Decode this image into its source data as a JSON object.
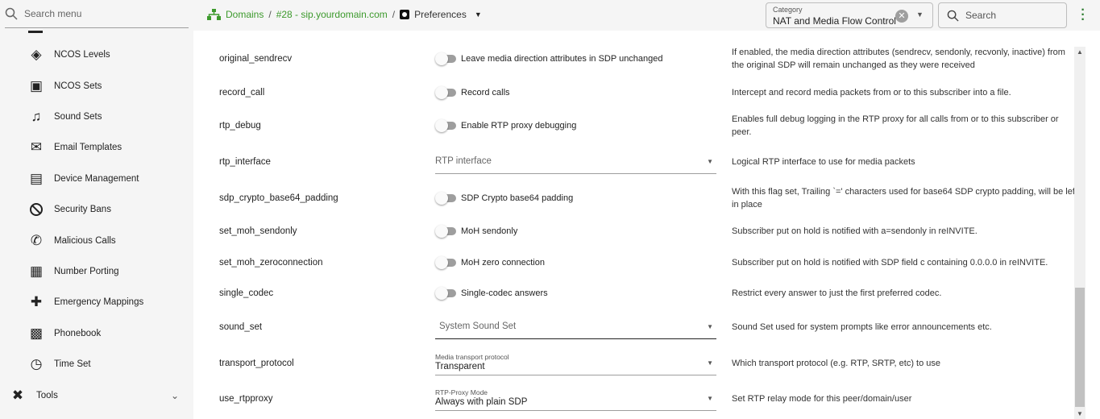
{
  "sidebar": {
    "search_placeholder": "Search menu",
    "items": [
      {
        "label": "NCOS Levels",
        "icon": "layers-icon"
      },
      {
        "label": "NCOS Sets",
        "icon": "ncos-sets-icon"
      },
      {
        "label": "Sound Sets",
        "icon": "music-note-icon"
      },
      {
        "label": "Email Templates",
        "icon": "email-icon"
      },
      {
        "label": "Device Management",
        "icon": "device-icon"
      },
      {
        "label": "Security Bans",
        "icon": "block-icon"
      },
      {
        "label": "Malicious Calls",
        "icon": "phone-icon"
      },
      {
        "label": "Number Porting",
        "icon": "sim-card-icon"
      },
      {
        "label": "Emergency Mappings",
        "icon": "medical-icon"
      },
      {
        "label": "Phonebook",
        "icon": "contacts-icon"
      },
      {
        "label": "Time Set",
        "icon": "clock-icon"
      }
    ],
    "tools": {
      "label": "Tools",
      "icon": "tools-icon"
    }
  },
  "header": {
    "breadcrumb": [
      "Domains",
      "#28 - sip.yourdomain.com",
      "Preferences"
    ],
    "category": {
      "label": "Category",
      "value": "NAT and Media Flow Control"
    },
    "search_placeholder": "Search"
  },
  "colors": {
    "accent": "#3d9a2d"
  },
  "rows": [
    {
      "name": "original_sendrecv",
      "type": "toggle",
      "control": "Leave media direction attributes in SDP unchanged",
      "value": false,
      "desc": "If enabled, the media direction attributes (sendrecv, sendonly, recvonly, inactive) from the original SDP will remain unchanged as they were received"
    },
    {
      "name": "record_call",
      "type": "toggle",
      "control": "Record calls",
      "value": false,
      "desc": "Intercept and record media packets from or to this subscriber into a file."
    },
    {
      "name": "rtp_debug",
      "type": "toggle",
      "control": "Enable RTP proxy debugging",
      "value": false,
      "desc": "Enables full debug logging in the RTP proxy for all calls from or to this subscriber or peer."
    },
    {
      "name": "rtp_interface",
      "type": "select",
      "placeholder": "RTP interface",
      "desc": "Logical RTP interface to use for media packets"
    },
    {
      "name": "sdp_crypto_base64_padding",
      "type": "toggle",
      "control": "SDP Crypto base64 padding",
      "value": false,
      "desc": "With this flag set, Trailing `=' characters used for base64 SDP crypto padding, will be left in place"
    },
    {
      "name": "set_moh_sendonly",
      "type": "toggle",
      "control": "MoH sendonly",
      "value": false,
      "desc": "Subscriber put on hold is notified with a=sendonly in reINVITE."
    },
    {
      "name": "set_moh_zeroconnection",
      "type": "toggle",
      "control": "MoH zero connection",
      "value": false,
      "desc": "Subscriber put on hold is notified with SDP field c containing 0.0.0.0 in reINVITE."
    },
    {
      "name": "single_codec",
      "type": "toggle",
      "control": "Single-codec answers",
      "value": false,
      "desc": "Restrict every answer to just the first preferred codec."
    },
    {
      "name": "sound_set",
      "type": "select",
      "placeholder": "System Sound Set",
      "desc": "Sound Set used for system prompts like error announcements etc."
    },
    {
      "name": "transport_protocol",
      "type": "select",
      "label": "Media transport protocol",
      "value": "Transparent",
      "desc": "Which transport protocol (e.g. RTP, SRTP, etc) to use"
    },
    {
      "name": "use_rtpproxy",
      "type": "select",
      "label": "RTP-Proxy Mode",
      "value": "Always with plain SDP",
      "desc": "Set RTP relay mode for this peer/domain/user"
    }
  ]
}
